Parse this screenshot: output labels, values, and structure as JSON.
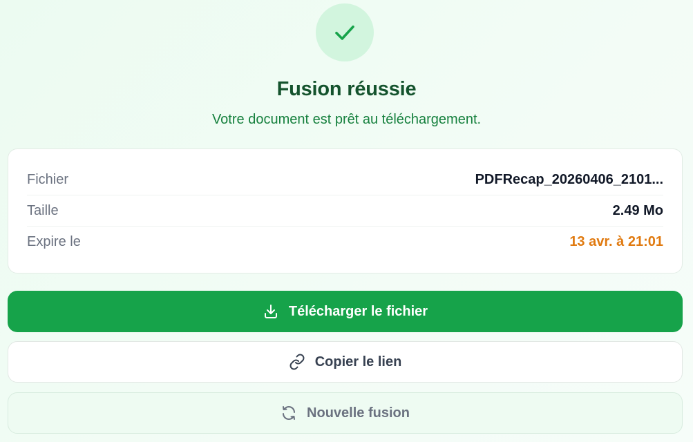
{
  "status": {
    "icon": "checkmark-icon",
    "title": "Fusion réussie",
    "subtitle": "Votre document est prêt au téléchargement."
  },
  "file_info": {
    "rows": [
      {
        "label": "Fichier",
        "value": "PDFRecap_20260406_2101..."
      },
      {
        "label": "Taille",
        "value": "2.49 Mo"
      },
      {
        "label": "Expire le",
        "value": "13 avr. à 21:01"
      }
    ]
  },
  "actions": {
    "download_label": "Télécharger le fichier",
    "download_icon": "download-icon",
    "copy_label": "Copier le lien",
    "copy_icon": "link-icon",
    "new_label": "Nouvelle fusion",
    "new_icon": "refresh-icon"
  },
  "colors": {
    "success_bg": "#d2f5de",
    "success_green": "#16a34a",
    "title_green": "#14532d",
    "expire_orange": "#e07a10"
  }
}
